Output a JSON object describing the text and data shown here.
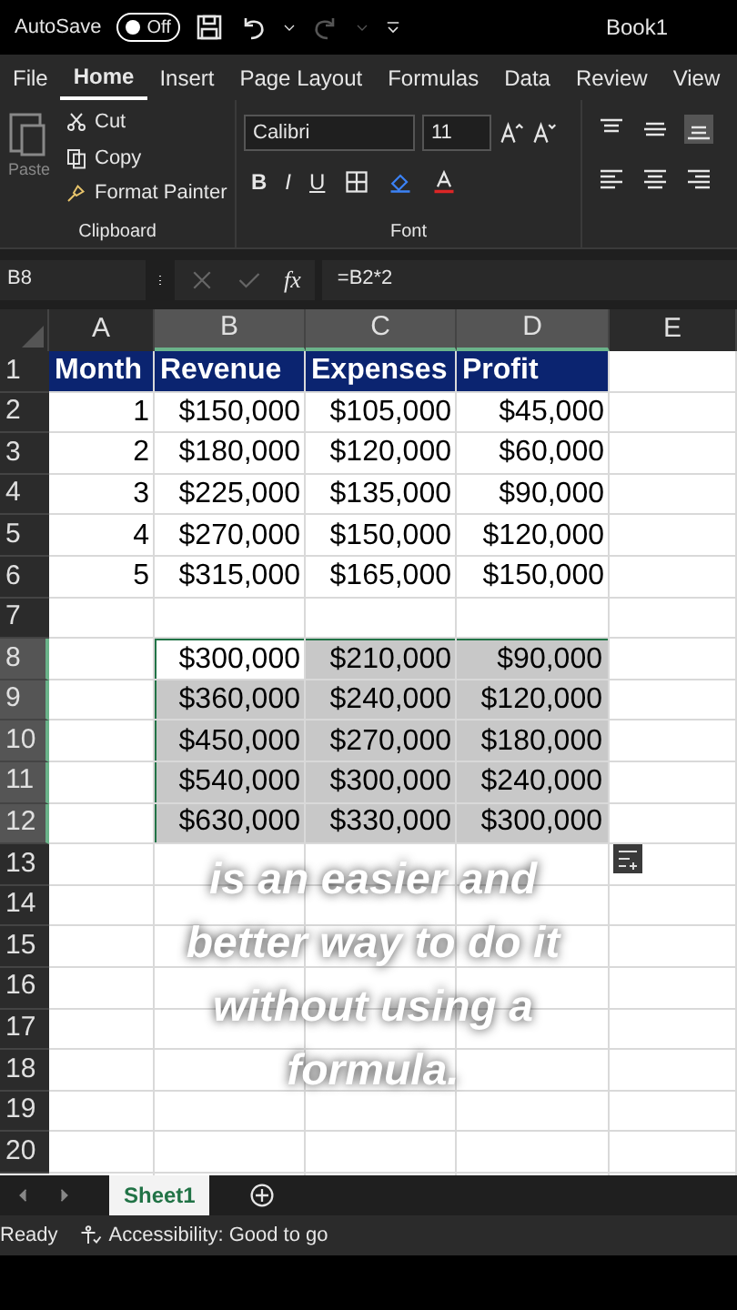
{
  "title_bar": {
    "autosave_label": "AutoSave",
    "autosave_toggle": {
      "label": "Off",
      "on": false
    },
    "title": "Book1"
  },
  "ribbon_tabs": [
    {
      "label": "File",
      "selected": false
    },
    {
      "label": "Home",
      "selected": true
    },
    {
      "label": "Insert",
      "selected": false
    },
    {
      "label": "Page Layout",
      "selected": false
    },
    {
      "label": "Formulas",
      "selected": false
    },
    {
      "label": "Data",
      "selected": false
    },
    {
      "label": "Review",
      "selected": false
    },
    {
      "label": "View",
      "selected": false
    }
  ],
  "clipboard": {
    "paste": "Paste",
    "cut": "Cut",
    "copy": "Copy",
    "format_painter": "Format Painter",
    "group": "Clipboard"
  },
  "font": {
    "name": "Calibri",
    "size": "11",
    "styles": [
      "B",
      "I",
      "U"
    ],
    "group": "Font"
  },
  "formula_bar": {
    "name_box": "B8",
    "fx": "fx",
    "formula": "=B2*2"
  },
  "columns": [
    {
      "label": "A",
      "selected": false
    },
    {
      "label": "B",
      "selected": true
    },
    {
      "label": "C",
      "selected": true
    },
    {
      "label": "D",
      "selected": true
    },
    {
      "label": "E",
      "selected": false
    }
  ],
  "rows": [
    {
      "label": "1",
      "selected": false,
      "kind": "header",
      "cells": {
        "A": {
          "text": "Month"
        },
        "B": {
          "text": "Revenue"
        },
        "C": {
          "text": "Expenses"
        },
        "D": {
          "text": "Profit"
        }
      }
    },
    {
      "label": "2",
      "selected": false,
      "kind": "data",
      "cells": {
        "A": {
          "text": "1"
        },
        "B": {
          "text": "$150,000"
        },
        "C": {
          "text": "$105,000"
        },
        "D": {
          "text": "$45,000"
        }
      }
    },
    {
      "label": "3",
      "selected": false,
      "kind": "data",
      "cells": {
        "A": {
          "text": "2"
        },
        "B": {
          "text": "$180,000"
        },
        "C": {
          "text": "$120,000"
        },
        "D": {
          "text": "$60,000"
        }
      }
    },
    {
      "label": "4",
      "selected": false,
      "kind": "data",
      "cells": {
        "A": {
          "text": "3"
        },
        "B": {
          "text": "$225,000"
        },
        "C": {
          "text": "$135,000"
        },
        "D": {
          "text": "$90,000"
        }
      }
    },
    {
      "label": "5",
      "selected": false,
      "kind": "data",
      "cells": {
        "A": {
          "text": "4"
        },
        "B": {
          "text": "$270,000"
        },
        "C": {
          "text": "$150,000"
        },
        "D": {
          "text": "$120,000"
        }
      }
    },
    {
      "label": "6",
      "selected": false,
      "kind": "data",
      "cells": {
        "A": {
          "text": "5"
        },
        "B": {
          "text": "$315,000"
        },
        "C": {
          "text": "$165,000"
        },
        "D": {
          "text": "$150,000"
        }
      }
    },
    {
      "label": "7",
      "selected": false,
      "kind": "data"
    },
    {
      "label": "8",
      "selected": true,
      "kind": "data",
      "cells": {
        "B": {
          "text": "$300,000",
          "active": true
        },
        "C": {
          "text": "$210,000",
          "active": false
        },
        "D": {
          "text": "$90,000",
          "active": false
        }
      }
    },
    {
      "label": "9",
      "selected": true,
      "kind": "data",
      "cells": {
        "B": {
          "text": "$360,000",
          "active": false
        },
        "C": {
          "text": "$240,000",
          "active": false
        },
        "D": {
          "text": "$120,000",
          "active": false
        }
      }
    },
    {
      "label": "10",
      "selected": true,
      "kind": "data",
      "cells": {
        "B": {
          "text": "$450,000",
          "active": false
        },
        "C": {
          "text": "$270,000",
          "active": false
        },
        "D": {
          "text": "$180,000",
          "active": false
        }
      }
    },
    {
      "label": "11",
      "selected": true,
      "kind": "data",
      "cells": {
        "B": {
          "text": "$540,000",
          "active": false
        },
        "C": {
          "text": "$300,000",
          "active": false
        },
        "D": {
          "text": "$240,000",
          "active": false
        }
      }
    },
    {
      "label": "12",
      "selected": true,
      "kind": "data",
      "cells": {
        "B": {
          "text": "$630,000",
          "active": false
        },
        "C": {
          "text": "$330,000",
          "active": false
        },
        "D": {
          "text": "$300,000",
          "active": false
        }
      }
    },
    {
      "label": "13",
      "selected": false,
      "kind": "data"
    },
    {
      "label": "14",
      "selected": false,
      "kind": "data"
    },
    {
      "label": "15",
      "selected": false,
      "kind": "data"
    },
    {
      "label": "16",
      "selected": false,
      "kind": "data"
    },
    {
      "label": "17",
      "selected": false,
      "kind": "data"
    },
    {
      "label": "18",
      "selected": false,
      "kind": "data"
    },
    {
      "label": "19",
      "selected": false,
      "kind": "data"
    },
    {
      "label": "20",
      "selected": false,
      "kind": "data"
    }
  ],
  "caption": "is an easier and better way to do it without using a formula.",
  "sheet_tabs": [
    {
      "label": "Sheet1",
      "selected": true
    }
  ],
  "status_bar": {
    "status": "Ready",
    "accessibility": "Accessibility: Good to go"
  }
}
